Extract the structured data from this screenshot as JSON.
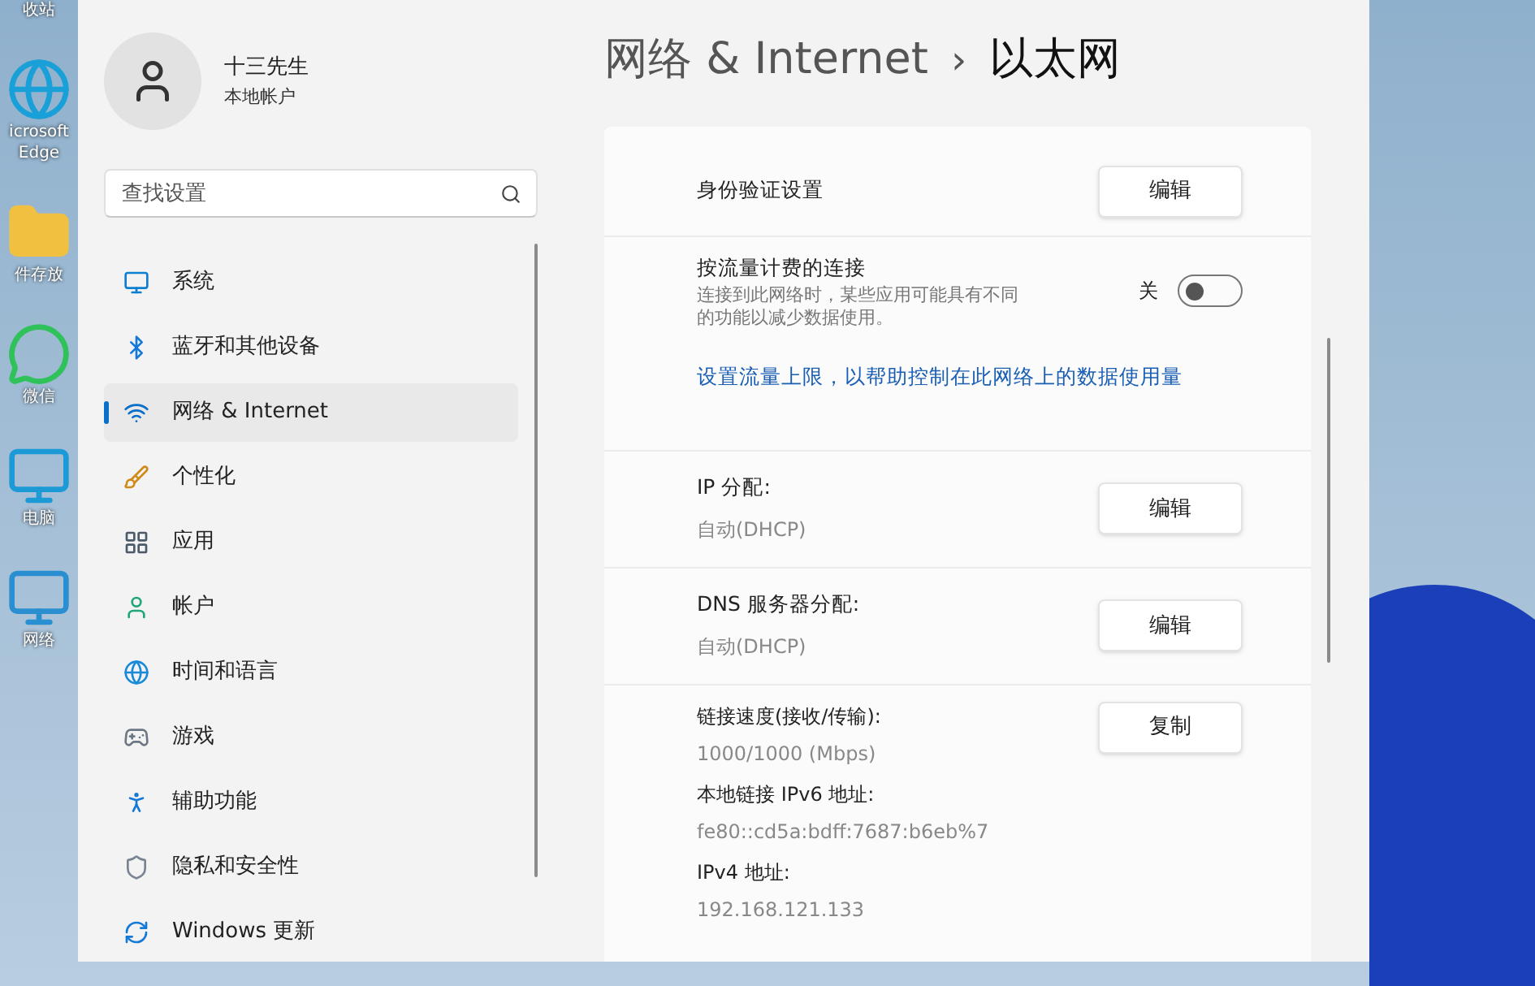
{
  "desktop_icons": [
    {
      "kind": "bin",
      "lines": [
        "收站"
      ]
    },
    {
      "kind": "browser",
      "lines": [
        "icrosoft",
        "Edge"
      ]
    },
    {
      "kind": "folder",
      "lines": [
        "件存放"
      ]
    },
    {
      "kind": "chat",
      "lines": [
        "微信"
      ]
    },
    {
      "kind": "computer",
      "lines": [
        "电脑"
      ]
    },
    {
      "kind": "network",
      "lines": [
        "网络"
      ]
    }
  ],
  "sidebar": {
    "user": {
      "name": "十三先生",
      "account_type": "本地帐户"
    },
    "search": {
      "placeholder": "查找设置"
    },
    "items": [
      {
        "kind": "system",
        "label": "系统",
        "selected": false
      },
      {
        "kind": "bluetooth",
        "label": "蓝牙和其他设备",
        "selected": false
      },
      {
        "kind": "network",
        "label": "网络 & Internet",
        "selected": true
      },
      {
        "kind": "personalization",
        "label": "个性化",
        "selected": false
      },
      {
        "kind": "apps",
        "label": "应用",
        "selected": false
      },
      {
        "kind": "accounts",
        "label": "帐户",
        "selected": false
      },
      {
        "kind": "time",
        "label": "时间和语言",
        "selected": false
      },
      {
        "kind": "gaming",
        "label": "游戏",
        "selected": false
      },
      {
        "kind": "accessibility",
        "label": "辅助功能",
        "selected": false
      },
      {
        "kind": "privacy",
        "label": "隐私和安全性",
        "selected": false
      },
      {
        "kind": "update",
        "label": "Windows 更新",
        "selected": false
      }
    ]
  },
  "breadcrumb": {
    "parent": "网络 & Internet",
    "separator": "›",
    "current": "以太网"
  },
  "settings": [
    {
      "kind": "button",
      "label": "身份验证设置",
      "button": "编辑"
    },
    {
      "kind": "toggle",
      "label": "按流量计费的连接",
      "description": "连接到此网络时，某些应用可能具有不同的功能以减少数据使用。",
      "state_label": "关",
      "on": false
    },
    {
      "kind": "link",
      "text": "设置流量上限，以帮助控制在此网络上的数据使用量"
    },
    {
      "kind": "button",
      "label": "IP 分配:",
      "value": "自动(DHCP)",
      "button": "编辑"
    },
    {
      "kind": "button",
      "label": "DNS 服务器分配:",
      "value": "自动(DHCP)",
      "button": "编辑"
    },
    {
      "kind": "properties",
      "button": "复制",
      "pairs": [
        {
          "label": "链接速度(接收/传输):",
          "value": "1000/1000 (Mbps)"
        },
        {
          "label": "本地链接 IPv6 地址:",
          "value": "fe80::cd5a:bdff:7687:b6eb%7"
        },
        {
          "label": "IPv4 地址:",
          "value": "192.168.121.133"
        }
      ]
    }
  ]
}
